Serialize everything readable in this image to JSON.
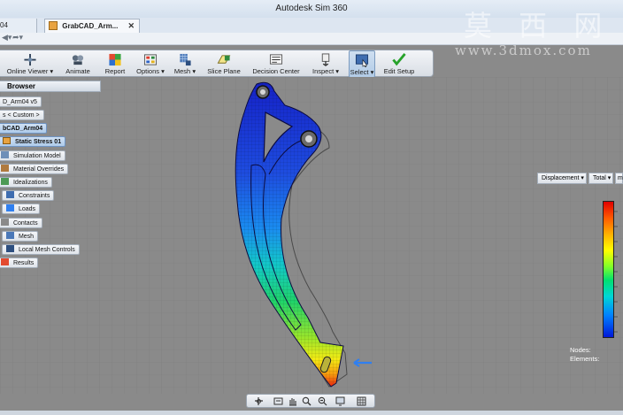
{
  "app": {
    "title": "Autodesk Sim 360"
  },
  "tabs": [
    {
      "label": "04",
      "active": false
    },
    {
      "label": "GrabCAD_Arm...",
      "active": true,
      "close": "✕"
    }
  ],
  "ribbon": {
    "buttons": [
      {
        "label": "Online Viewer ▾",
        "icon": "plus-cross-icon"
      },
      {
        "label": "Animate",
        "icon": "animate-icon"
      },
      {
        "label": "Report",
        "icon": "report-icon"
      },
      {
        "label": "Options ▾",
        "icon": "options-icon"
      },
      {
        "label": "Mesh ▾",
        "icon": "mesh-icon"
      },
      {
        "label": "Slice Plane",
        "icon": "slice-plane-icon"
      },
      {
        "label": "Decision Center",
        "icon": "decision-center-icon"
      },
      {
        "label": "Inspect ▾",
        "icon": "inspect-icon"
      },
      {
        "label": "Select ▾",
        "icon": "select-icon"
      },
      {
        "label": "Edit Setup",
        "icon": "checkmark-icon"
      }
    ]
  },
  "browser": {
    "title": "Browser",
    "nodes": [
      {
        "label": "D_Arm04 v5",
        "icon": ""
      },
      {
        "label": "s < Custom >",
        "icon": ""
      },
      {
        "label": "bCAD_Arm04",
        "icon": ""
      },
      {
        "label": "Static Stress 01",
        "icon": "study-icon"
      },
      {
        "label": "Simulation Model",
        "icon": "model-icon"
      },
      {
        "label": "Material Overrides",
        "icon": "material-icon"
      },
      {
        "label": "Idealizations",
        "icon": "idealization-icon"
      },
      {
        "label": "Constraints",
        "icon": "constraint-icon"
      },
      {
        "label": "Loads",
        "icon": "load-icon"
      },
      {
        "label": "Contacts",
        "icon": "contact-icon"
      },
      {
        "label": "Mesh",
        "icon": "mesh-icon"
      },
      {
        "label": "Local Mesh Controls",
        "icon": "mesh-control-icon"
      },
      {
        "label": "Results",
        "icon": "results-icon"
      }
    ]
  },
  "results": {
    "type_dropdown": "Displacement ▾",
    "component_dropdown": "Total ▾",
    "extra_dropdown": "m",
    "nodes_label": "Nodes:",
    "elements_label": "Elements:"
  },
  "colors": {
    "viewport_bg": "#8a8a8a",
    "grid_line": "#7d7d7d",
    "legend_top": "#e00000",
    "legend_bottom": "#0018d8",
    "load_arrow": "#2f7ff0"
  },
  "watermark": {
    "text": "莫 西 网",
    "url": "www.3dmox.com"
  }
}
